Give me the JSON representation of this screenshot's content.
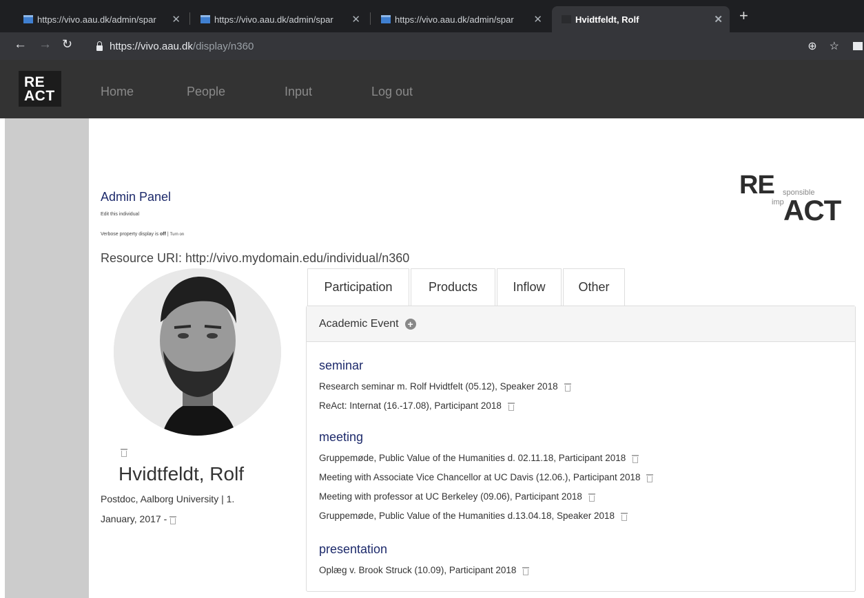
{
  "browser": {
    "tabs": [
      {
        "title": "https://vivo.aau.dk/admin/spar"
      },
      {
        "title": "https://vivo.aau.dk/admin/spar"
      },
      {
        "title": "https://vivo.aau.dk/admin/spar"
      },
      {
        "title": "Hvidtfeldt, Rolf"
      }
    ],
    "url_host": "https://vivo.aau.dk",
    "url_path": "/display/n360"
  },
  "site": {
    "logo": {
      "line1": "RE",
      "line2": "ACT"
    },
    "menu": [
      "Home",
      "People",
      "Input",
      "Log out"
    ],
    "brand": {
      "re": "RE",
      "sponsible": "sponsible",
      "imp": "imp",
      "act": "ACT"
    }
  },
  "admin": {
    "title": "Admin Panel",
    "edit_link": "Edit this individual",
    "verbose_prefix": "Verbose property display is ",
    "verbose_state": "off",
    "verbose_sep": " | ",
    "verbose_link": "Turn on",
    "resource_uri": "Resource URI: http://vivo.mydomain.edu/individual/n360"
  },
  "person": {
    "name": "Hvidtfeldt, Rolf",
    "position_line1": "Postdoc, Aalborg University | 1.",
    "position_line2": "January, 2017 -"
  },
  "profile_tabs": [
    "Participation",
    "Products",
    "Inflow",
    "Other"
  ],
  "panel": {
    "heading": "Academic Event",
    "groups": [
      {
        "title": "seminar",
        "items": [
          "Research seminar m. Rolf Hvidtfelt (05.12), Speaker 2018",
          "ReAct: Internat (16.-17.08), Participant 2018"
        ]
      },
      {
        "title": "meeting",
        "items": [
          "Gruppemøde, Public Value of the Humanities d. 02.11.18, Participant 2018",
          "Meeting with Associate Vice Chancellor at UC Davis (12.06.), Participant 2018",
          "Meeting with professor at UC Berkeley (09.06), Participant 2018",
          "Gruppemøde, Public Value of the Humanities d.13.04.18, Speaker 2018"
        ]
      },
      {
        "title": "presentation",
        "items": [
          "Oplæg v. Brook Struck (10.09), Participant 2018"
        ]
      }
    ]
  }
}
